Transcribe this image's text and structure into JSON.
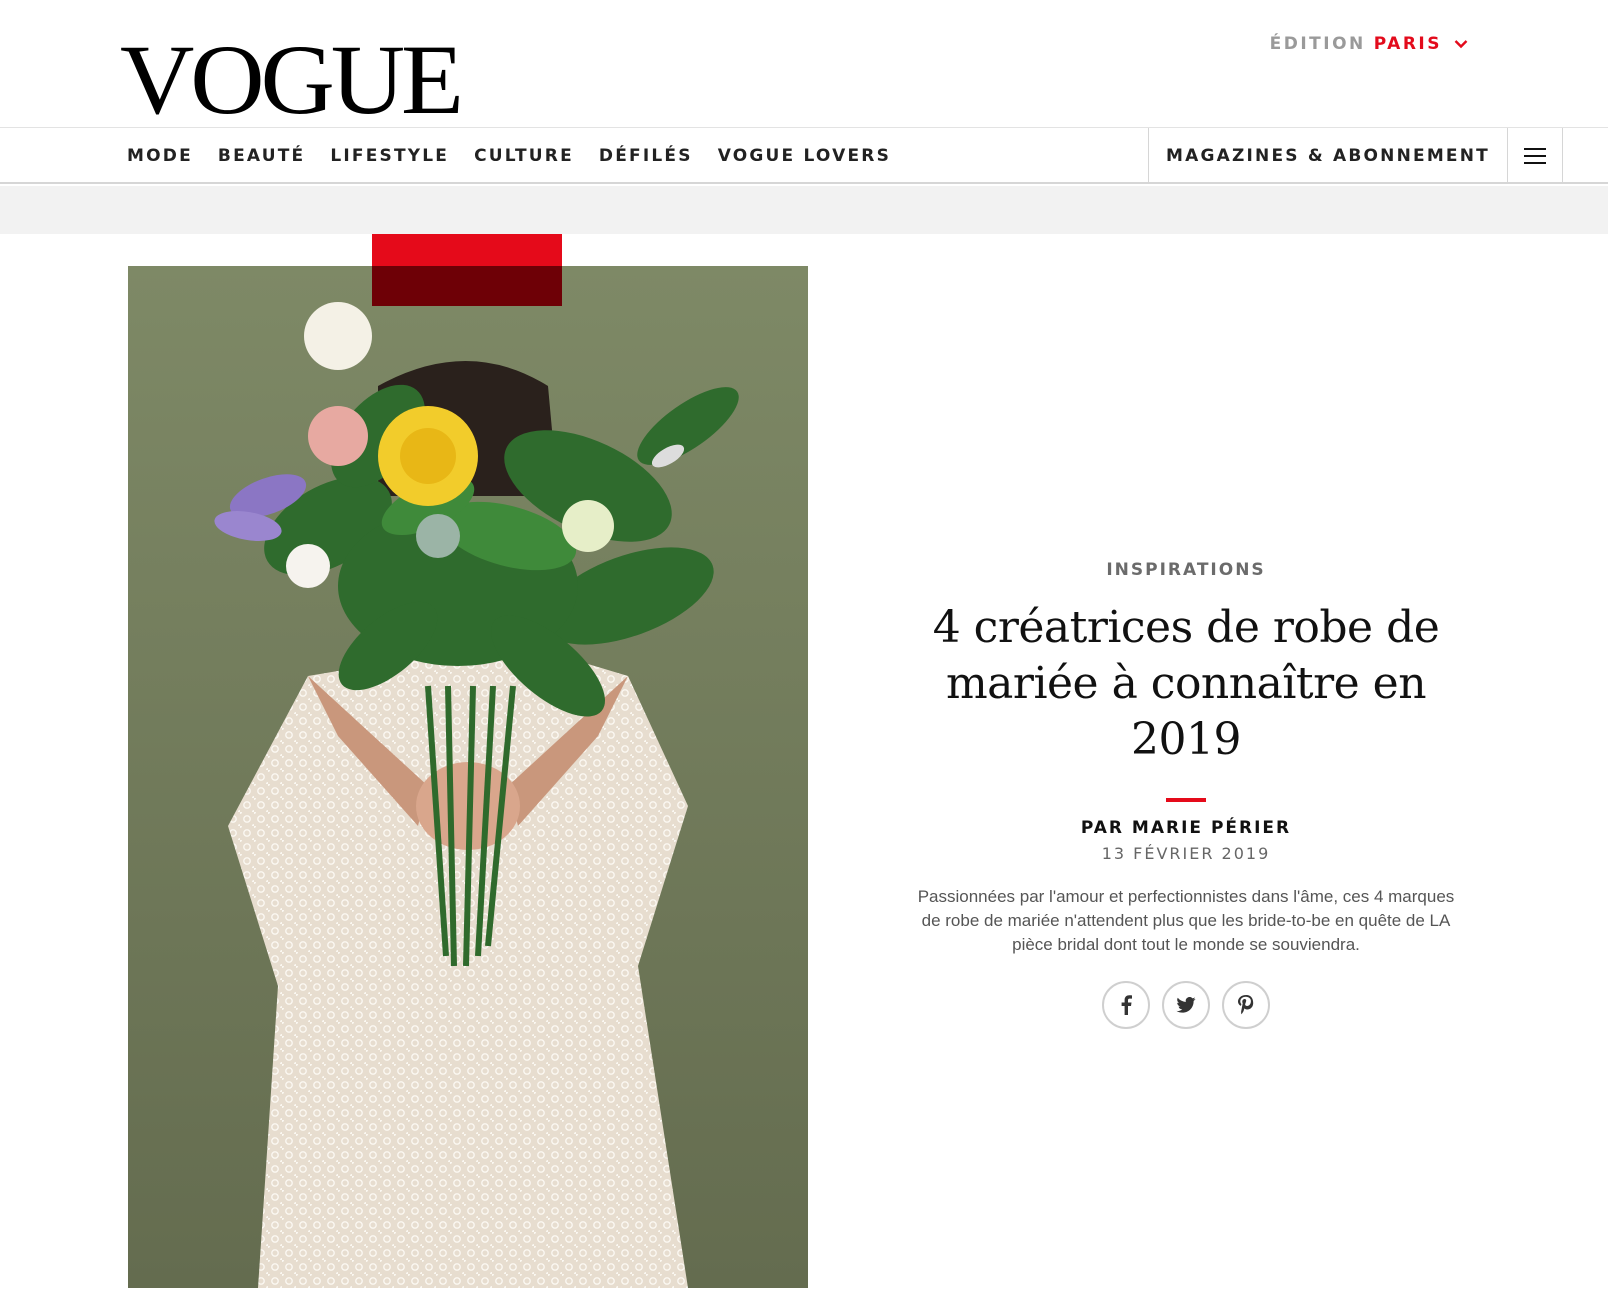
{
  "header": {
    "logo_text": "VOGUE",
    "edition_label": "ÉDITION",
    "edition_city": "PARIS"
  },
  "nav": {
    "items": [
      {
        "label": "MODE"
      },
      {
        "label": "BEAUTÉ"
      },
      {
        "label": "LIFESTYLE"
      },
      {
        "label": "CULTURE"
      },
      {
        "label": "DÉFILÉS"
      },
      {
        "label": "VOGUE LOVERS"
      }
    ],
    "subscription_label": "MAGAZINES & ABONNEMENT",
    "menu_icon": "hamburger-menu-icon"
  },
  "article": {
    "category": "INSPIRATIONS",
    "title": "4 créatrices de robe de mariée à connaître en 2019",
    "author": "PAR MARIE PÉRIER",
    "date": "13 FÉVRIER 2019",
    "dek": "Passionnées par l'amour et perfectionnistes dans l'âme, ces 4 marques de robe de mariée n'attendent plus que les bride-to-be en quête de LA pièce bridal dont tout le monde se souviendra.",
    "share": [
      {
        "icon": "facebook-icon"
      },
      {
        "icon": "twitter-icon"
      },
      {
        "icon": "pinterest-icon"
      }
    ]
  },
  "colors": {
    "accent": "#e50a1a",
    "photo_background": "#7f8a68"
  }
}
